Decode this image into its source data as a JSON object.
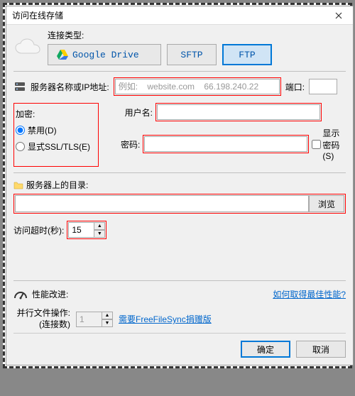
{
  "window": {
    "title": "访问在线存储"
  },
  "connType": {
    "label": "连接类型:",
    "gdrive": "Google Drive",
    "sftp": "SFTP",
    "ftp": "FTP"
  },
  "server": {
    "label": "服务器名称或IP地址:",
    "placeholder": "例如:    website.com    66.198.240.22",
    "value": "",
    "port_label": "端口:",
    "port_value": ""
  },
  "encryption": {
    "label": "加密:",
    "opt_disable": "禁用(D)",
    "opt_ssl": "显式SSL/TLS(E)"
  },
  "credentials": {
    "user_label": "用户名:",
    "user_value": "",
    "pw_label": "密码:",
    "pw_value": "",
    "show_pw": "显示密码(S)"
  },
  "directory": {
    "label": "服务器上的目录:",
    "value": "",
    "browse": "浏览"
  },
  "timeout": {
    "label": "访问超时(秒):",
    "value": "15"
  },
  "performance": {
    "label": "性能改进:",
    "best_link": "如何取得最佳性能?"
  },
  "parallel": {
    "label": "并行文件操作:",
    "sublabel": "(连接数)",
    "value": "1",
    "donate_link": "需要FreeFileSync捐赠版"
  },
  "buttons": {
    "ok": "确定",
    "cancel": "取消"
  }
}
